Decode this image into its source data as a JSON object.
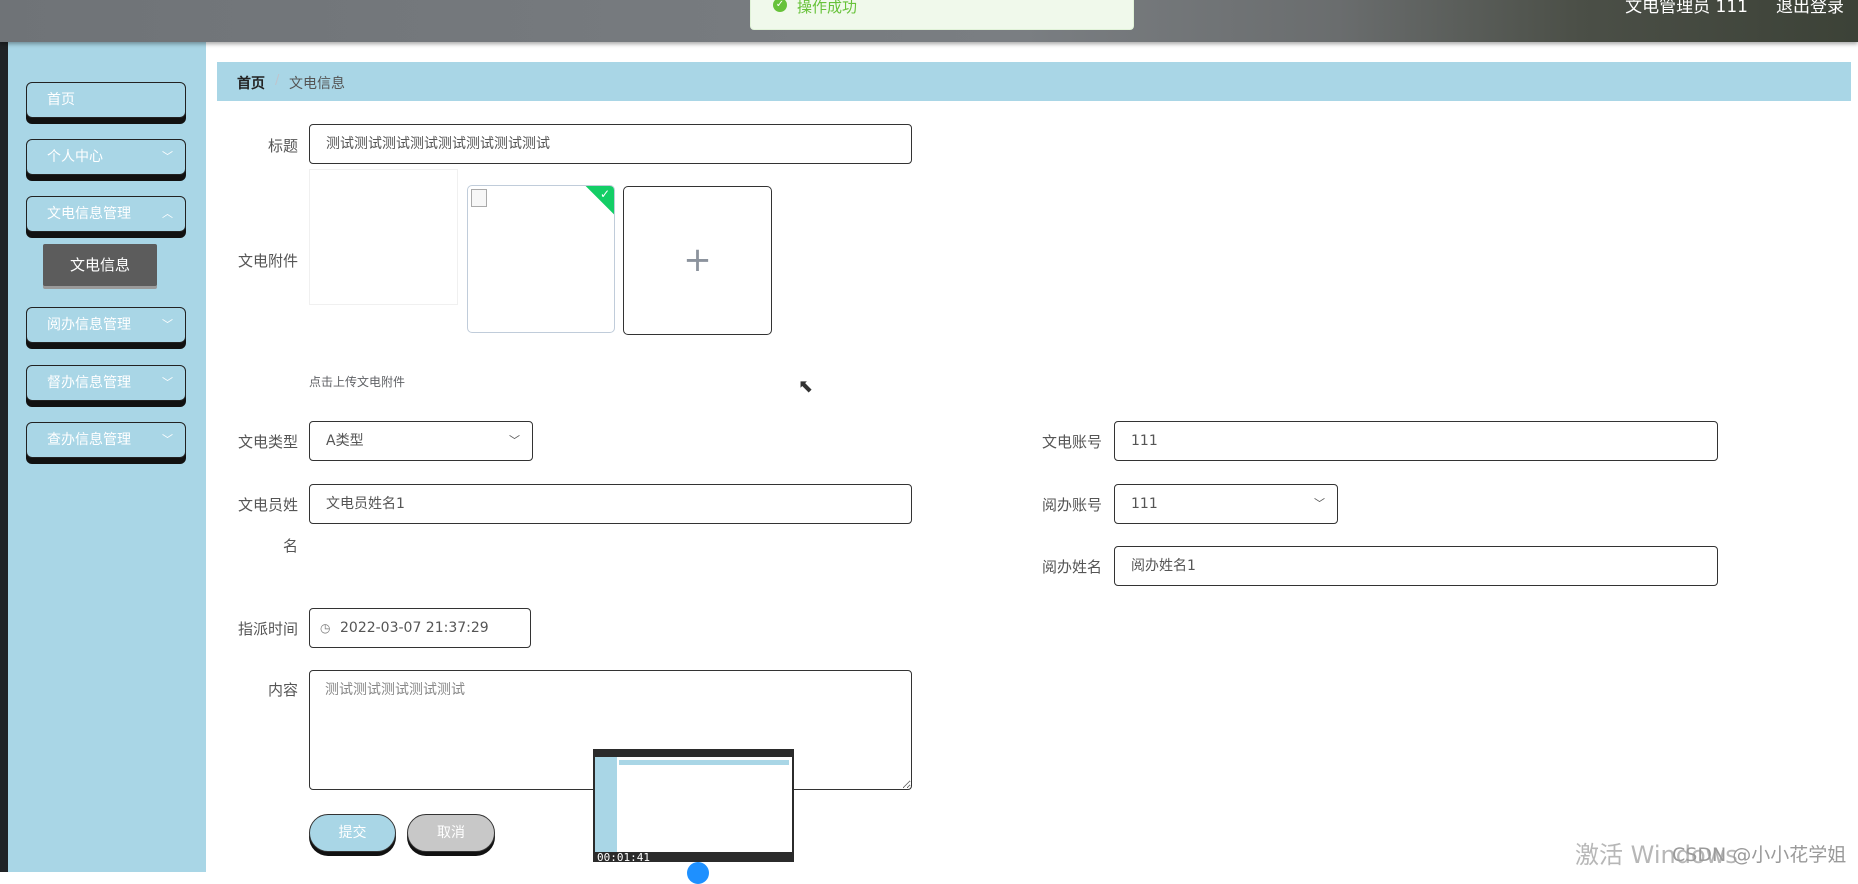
{
  "header": {
    "user": "文电管理员 111",
    "logout": "退出登录",
    "toast": "操作成功"
  },
  "sidebar": {
    "items": [
      {
        "label": "首页"
      },
      {
        "label": "个人中心"
      },
      {
        "label": "文电信息管理"
      },
      {
        "label": "阅办信息管理"
      },
      {
        "label": "督办信息管理"
      },
      {
        "label": "查办信息管理"
      }
    ],
    "sub_item": "文电信息"
  },
  "breadcrumb": {
    "home": "首页",
    "separator": "/",
    "current": "文电信息"
  },
  "form": {
    "title_label": "标题",
    "title_value": "测试测试测试测试测试测试测试测试",
    "attachment_label": "文电附件",
    "upload_hint": "点击上传文电附件",
    "type_label": "文电类型",
    "type_value": "A类型",
    "account_label": "文电账号",
    "account_value": "111",
    "clerk_name_label_1": "文电员姓",
    "clerk_name_label_2": "名",
    "clerk_name_value": "文电员姓名1",
    "review_account_label": "阅办账号",
    "review_account_value": "111",
    "review_name_label": "阅办姓名",
    "review_name_value": "阅办姓名1",
    "assign_time_label": "指派时间",
    "assign_time_value": "2022-03-07 21:37:29",
    "content_label": "内容",
    "content_placeholder": "测试测试测试测试测试",
    "submit": "提交",
    "cancel": "取消"
  },
  "video": {
    "time": "00:01:41"
  },
  "overlay": {
    "windows_activate": "激活 Windows",
    "csdn": "CSDN @小小花学姐"
  }
}
